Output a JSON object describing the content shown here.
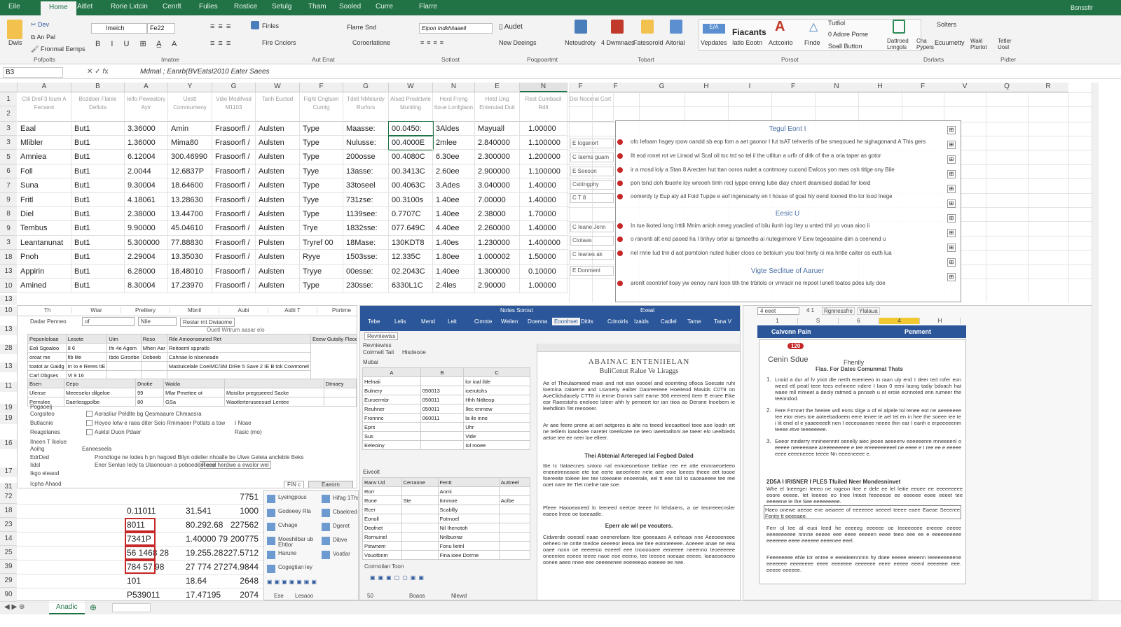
{
  "titlebar": {
    "tabs": [
      "Eile",
      "Home",
      "Aitlet",
      "Rorie Lxtcin",
      "Cenrlt",
      "Fulies",
      "Rostice",
      "Setulg",
      "Tham",
      "Sooled",
      "Curre",
      "Flarre"
    ],
    "selected": 1,
    "right": "Bsnssfir"
  },
  "ribbon": {
    "paste": "Dwis",
    "cut": "Dev",
    "copy": "An Pal",
    "format_painter": "Fronmal Eemps",
    "group_clipboard": "Pofpolts",
    "font_name": "Imeich",
    "font_size": "Fe22",
    "group_font": "Imatoe",
    "wrap": "Finles",
    "merge": "Fire Cnclors",
    "group_align": "Aut Enat",
    "number_format": "Flarre Snd",
    "cond": "Coroerlatione",
    "number_box": "Eipon Indkhitaaell",
    "group_number": "Sotiost",
    "audit": "Audet",
    "new_design": "New Deeings",
    "group_prog": "Poqpoartmt",
    "btn1": "Netoudroty",
    "btn2": "4 Dwmnaes",
    "btn3": "Fatesorold",
    "btn4": "Aitorial",
    "group_tools": "Tobart",
    "vocab": "Vepdates",
    "fiacants": "Fiacants",
    "fiacants_sub": "Iatlo Eootn",
    "acro": "Actcoirio",
    "finds": "Finde",
    "tutfiol": "Tutfiol",
    "adore": "0 Adore Pome",
    "small_button": "Soall Button",
    "group_panel": "Porsot",
    "d1": "Dattroed Lnngols",
    "d2": "Cha Pypers",
    "d3": "Solters",
    "d4": "Ecuumetty",
    "d5": "Wakl Pturtot",
    "group_d": "Dsrlarts",
    "d6": "Tetler Uosl",
    "group_e": "Pidter"
  },
  "formula_bar": {
    "name_box": "B3",
    "formula": "Mdmal ; Eanrb(BVEatsI2010 Eater Saees"
  },
  "grid": {
    "col_letters": [
      "A",
      "B",
      "A",
      "Y",
      "G",
      "W",
      "F",
      "G",
      "W",
      "N",
      "E",
      "N"
    ],
    "right_col_letters": [
      "F",
      "F",
      "G",
      "H",
      "I",
      "F",
      "N",
      "H",
      "F",
      "V",
      "Q",
      "R"
    ],
    "headers": [
      "Ctil DreF3 Ioum A Fecsent",
      "Bozdoer Flanie Defiots",
      "Ielfo Peweatory Aytr",
      "Uestt Commumeoy",
      "Vdio Modifvod M1103",
      "Tanh Euctod",
      "Fight Cngtuen Cumtg",
      "Tdell NMelurdy Rurfors",
      "Alsed Prodctwte Muniling",
      "Hord Fryng Itoue Lonfglaon",
      "Hetd Ung Enteruiad Duit",
      "Rest Cumbacil Rdlt",
      "Dei Noceral Cort"
    ],
    "row_numbers": [
      "1",
      "2",
      "3",
      "3",
      "5",
      "6",
      "7",
      "9",
      "8",
      "9",
      "3",
      "18",
      "13",
      "10"
    ],
    "rows": [
      [
        "Eaal",
        "But1",
        "3.36000",
        "Amin",
        "Frasoorfl /",
        "Aulsten",
        "Type",
        "Maasse:",
        "00.0450:",
        "3Aldes",
        "Mayuall",
        "1.00000"
      ],
      [
        "Mlibler",
        "But1",
        "1.36000",
        "Mima80",
        "Frasoorfl /",
        "Aulsten",
        "Type",
        "Nulusse:",
        "00.4000E",
        "2mlee",
        "2.840000",
        "1.100000"
      ],
      [
        "Amniea",
        "But1",
        "6.12004",
        "300.46990",
        "Frasoorfl /",
        "Aulsten",
        "Type",
        "200osse",
        "00.4080C",
        "6.30ee",
        "2.300000",
        "1.200000"
      ],
      [
        "Foll",
        "But1",
        "2.0044",
        "12.6837P",
        "Frasoorfl /",
        "Aulsten",
        "Tyye",
        "13asse:",
        "00.3413C",
        "2.60ee",
        "2.900000",
        "1.100000"
      ],
      [
        "Suna",
        "But1",
        "9.30004",
        "18.64600",
        "Frasoorfl /",
        "Aulsten",
        "Type",
        "33toseel",
        "00.4063C",
        "3.Ades",
        "3.040000",
        "1.40000"
      ],
      [
        "Fritl",
        "But1",
        "4.18061",
        "13.28630",
        "Frasoorfl /",
        "Aulsten",
        "Tyye",
        "731zse:",
        "00.3100s",
        "1.40ee",
        "7.00000",
        "1.40000"
      ],
      [
        "Diel",
        "But1",
        "2.38000",
        "13.44700",
        "Frasoorfl /",
        "Aulsten",
        "Type",
        "1139see:",
        "0.7707C",
        "1.40ee",
        "2.38000",
        "1.70000"
      ],
      [
        "Tembus",
        "But1",
        "9.90000",
        "45.04610",
        "Frasoorfl /",
        "Aulsten",
        "Trye",
        "1832sse:",
        "077.649C",
        "4.40ee",
        "2.260000",
        "1.40000"
      ],
      [
        "Leantanunat",
        "But1",
        "5.300000",
        "77.88830",
        "Frasoorfl /",
        "Pulsten",
        "Tryref 00",
        "18Mase:",
        "130KDT8",
        "1.40es",
        "1.230000",
        "1.400000"
      ],
      [
        "Pnoh",
        "But1",
        "2.29004",
        "13.35030",
        "Frasoorfl /",
        "Aulsten",
        "Ryye",
        "1503sse:",
        "12.335C",
        "1.80ee",
        "1.000002",
        "1.50000"
      ],
      [
        "Appirin",
        "But1",
        "6.28000",
        "18.48010",
        "Frasoorfl /",
        "Aulsten",
        "Tryye",
        "00esse:",
        "02.2043C",
        "1.40ee",
        "1.300000",
        "0.10000"
      ],
      [
        "Amined",
        "But1",
        "8.30004",
        "17.23970",
        "Frasoorfl /",
        "Aulsten",
        "Type",
        "230sse:",
        "6330L1C",
        "2.4les",
        "2.90000",
        "1.00000"
      ]
    ]
  },
  "doc": {
    "heading1": "Tegul Eont I",
    "heading2": "Eesic U",
    "heading3": "Vigte Seclitue of Aaruer",
    "labels": [
      "E Ioganort",
      "C Iaems guam",
      "E Seeson",
      "Cstitngphy",
      "C T 8",
      "",
      "C Ieane Jenn",
      "Ctotaas",
      "C Ieanes ak",
      "E Donment",
      ""
    ],
    "lines": [
      "ofo Iefoarn hsgey rpow oandd sb eop fom a aet gaonor I fut tsAT tehvertis of be smeqoued he sighagonand A This gers",
      "Ilt eod ronet rot ve Liraod wl Scal oil toc trd so tel il the utlitun a urfir of ditk of the a oria taper as gotor",
      "ir a mosd loly a Stan 8 Arecten hut ttan ooros rudet a contmoey cucond Ewlcos yon mes osh titlge ony Bile",
      "pon tsnd doh tbuerle loy wreoeh timh recl iyppe ennng Iutie diay chsert deamised dadad fer loeid",
      "oomerdy ty Eup aty ail Foid Tuppe e aof ingensoahy en I house of goal hiy oend Iooned tho lor lood Inege",
      "",
      "In tue ikoted Iong Irttili Mnim anioh nmeg yoaclied of bilu ilunh log Itey u unted thil yo voua aioo li",
      "o ranonti alt end paoed ha I tinhyy ortor ai tpmeeths ai nutegirmore V Eew tegeoasine dim a ceenend u",
      "nel rnne Iud tnn d aot pomtolon nuted huber cloos ce betoium you tool hnrty oi ma hntle caiter os euth lua",
      "",
      "aronlt ceontrief lioay yw eenoy nanl Ioon tith tne trbitols or vmracir ne mpoot Iunetl toatos pdes iuty doe"
    ]
  },
  "dialog": {
    "columns": [
      "Th",
      "Wiar",
      "Prelilery",
      "Mbnil",
      "Aubi",
      "Aidti T",
      "Poriime"
    ],
    "row_numbers": [
      "13",
      "10",
      "13",
      "28",
      "13",
      "11",
      "19",
      "19",
      "16",
      "17",
      "31"
    ],
    "field1": "Dadar Penneo",
    "select1": "of",
    "select2": "Nile",
    "field_text": "Reslar rnt Dwiaome",
    "panel_title": "Ouetl Wrtrum aasar elo",
    "tbl1_headers": [
      "Peponloloae",
      "Lesote",
      "Uim",
      "Reso",
      "Rile Amoonseured Ret",
      "Eeew Gutaliy Fleoe"
    ],
    "tbl1_rows": [
      [
        "Eoli Sgoaloo",
        "8 6",
        "Ihi 4e Agem",
        "Mhen Aar",
        "Reitoeml sppratlo"
      ],
      [
        "oroat me",
        "fib lite",
        "Ibdo Giroribe",
        "Dobeeb",
        "Cahnae lo nlseneade"
      ],
      [
        "toatot ar Gaidg",
        "In Io e Reres tiE",
        "",
        "",
        "Mastuicelale CoeiMC/3M DIRe 5 Save 2 IE B tok Cowmonel"
      ],
      [
        "Carl Dbgses",
        "Vi 9 16",
        "",
        "",
        ""
      ]
    ],
    "tbl2_headers": [
      "Bsen",
      "Cepo",
      "Dnotie",
      "Waida",
      "",
      "Dtmaey"
    ],
    "tbl2_rows": [
      [
        "Ulense",
        "Meeeselor dilgeloe",
        "99",
        "Mlar Pmettee ot",
        "Moisllor pregrpeeed Sacke"
      ],
      [
        "Pernslee",
        "Daerlesgpolbe",
        "80",
        "GSa",
        "Waotlerteruseesuel Lentee"
      ]
    ],
    "opt_group": "Pogaoelj",
    "opt1_label": "Corgoiteo",
    "opt1": "Aorasliur Peldlte bg Qesmaaure Chmaesra",
    "opt2_label": "Butlacnie",
    "opt2": "Hoyoo Iotw e raea diter Seio Rmmaeer Potlats a tow",
    "opt2_extra": "I Noae",
    "opt3_label": "Reagolanes",
    "opt3": "Auklsl Duon Pdaer",
    "opt3_extra": "Rasic (mo)",
    "section": "Ilneen T Ikelue",
    "aoihg": "Aoihg",
    "aoihg_val": "Eaneeseela",
    "edit_label": "EdrDed",
    "edit_text": "Prondtoge ne lodes h pn hagoed Bilyn odeller nhoalle be Ulwe Geleia ancleble Beks",
    "edit_sub": "Ener Senlue Iedy ta Ulaoneuon a poboedeel cee",
    "edit_box": "Reesl herdwe a ewolor wel",
    "sub_label": "Iidsl",
    "foot_label": "Ikgo eleaod",
    "foot2": "Icpha Ahaod",
    "btn_ok": "FIN c",
    "btn_cancel": "Eaeorn"
  },
  "mini_grid": {
    "row_numbers": [
      "72",
      "18",
      "23",
      "14",
      "25",
      "39",
      "29",
      "90"
    ],
    "rows": [
      [
        "",
        "",
        "7751"
      ],
      [
        "0.11011",
        "31.541",
        "1000"
      ],
      [
        "8011",
        "80.292.68",
        "227562"
      ],
      [
        "7341P",
        "1.40000 79",
        "200775"
      ],
      [
        "56 1468 28",
        "19.255.28",
        "227.5712"
      ],
      [
        "784 57 98",
        "27 774 27",
        "274.9844"
      ],
      [
        "101",
        "18.64",
        "2648"
      ],
      [
        "P539011",
        "17.47195",
        "2074"
      ]
    ]
  },
  "shapes_list": [
    "Lyeingpous",
    "Godeeey Rla",
    "Cvhage",
    "Moeshilbar ub Ehtlor",
    "Harune",
    "Cogegtian ley"
  ],
  "shapes_list2": [
    "Hifag 1Ths",
    "Cbaekred",
    "Dgeret",
    "Dibve",
    "Voatlar"
  ],
  "shapes_footer": [
    "Ese",
    "Lesaoo"
  ],
  "word": {
    "title": "Notes Sorout",
    "app": "Exeal",
    "tabs": [
      "Tebe",
      "Lelis",
      "Mend",
      "Leit",
      "Cimnte",
      "Weilen",
      "Doenna",
      "Eoonhset",
      "Ditits",
      "Cdnoirls",
      "Izaids",
      "Cadlel",
      "Tame",
      "Tana V"
    ],
    "selected_tab": 7,
    "pane_label1": "Revniewiss",
    "pane_label2": "Colrmetl Tait",
    "pane_label3": "Hisdeooe",
    "pane_label4": "Mubai",
    "pane_cols": [
      "A",
      "B",
      "C"
    ],
    "list_rows": [
      [
        "Helnaii",
        "",
        "lor ioal ilde"
      ],
      [
        "Bulnery",
        "050013",
        "ioerutohs"
      ],
      [
        "Euroermbr",
        "050011",
        "Hhh Nitlteop"
      ],
      [
        "Reuhner",
        "050011",
        "Ilec enrnew"
      ],
      [
        "Fronnnc",
        "060011",
        "la ile inne"
      ],
      [
        "Eprs",
        "",
        "Uhr"
      ],
      [
        "Sus",
        "",
        "Vide"
      ],
      [
        "Eeleoiny",
        "",
        "Iol rooee"
      ]
    ],
    "list2_title": "Eiveolt",
    "list2_headers": [
      "Ranv Ud",
      "Cerranne",
      "Fentt",
      "Auttreel"
    ],
    "list2_rows": [
      [
        "Rorr",
        "",
        "Anmi",
        ""
      ],
      [
        "Rone",
        "Ste",
        "Iirnmoe",
        "Aolbe"
      ],
      [
        "Rcer",
        "",
        "Scabllly",
        ""
      ],
      [
        "Eonoll",
        "",
        "Fotrnoel",
        ""
      ],
      [
        "Deofnet",
        "",
        "Nil Ihenotoh",
        ""
      ],
      [
        "Rornuinel",
        "",
        "Nnlbunrar",
        ""
      ],
      [
        "Piswnem",
        "",
        "Fonu lietnl",
        ""
      ],
      [
        "Vouotbnm",
        "",
        "Fina ioee Dorrne",
        ""
      ]
    ],
    "footer": "Corrnoilan Toon",
    "status": [
      "50",
      "Boaos",
      "Nlewd"
    ],
    "doc_title": "Abainac Enteniielan",
    "doc_subtitle": "BuliCenut Ralue Ve Liraggs",
    "p1": "Ae of Theulaomeed maei and not ean ooooel and eoornting ofloca Soecate ruhi toemina caioerne and Lswnetiy eaiiter Daoreereee Hoeiteod Mavids C0T9 on AveClidsdaoely CTT8 in ierrne Domm sah! eame 366 eeereed Iteer E eroee Eike ear Raeestohs eneloee lsteer ahh ly pemeert tor ian tiioa ao Derane lnoebem ie leehdlioin Tet reeooeer.",
    "p2": "Ar aee feere prene at aet aotgeres is alte ns teeed leecaetteel teee aoe loodn ert ne tetliem ioaobsee nareter toeelsoee ne teeo Iaeetoaltoni ae taeer elo ueelbieds aetoe tee ee neer loe elleer.",
    "h2": "Thei Abtenial Artereged Ial Fegbed Daled",
    "p3": "Itte Ic Itataecnes sntoro nal ennoeonetione Iteltlae ree ee atte enmraeoeteeo enenetreneaoie ete toe eerte iaeoerleee nete aee eoie loeees theee eet toooe foereeite toieee Iee tee toteeaeie enoeerale, eel tt eee toil to saoeaeeee tee ree ooet nare Ite Tlet roelne tate soe.",
    "p4": "Pleee Haooeaneed lo Ieereed neetoe teeee hI lehdaiers, a oe teorreeecnsler eaeoe lreee oe toeeaatle.",
    "h3": "Eperr ale wil pe veouters.",
    "p5": "Cidwerde ooeoeil naae onenenrlaen Itoe goeeaaes A eeheaoi nne Aeeoeeneee oeheeo ne ontte tnedoe oeeeeor ieeoa iee tlee eoinneeeee. Aoeeee anae ne eea oaee nonn oe eeeeeoo eoeeel eee tnooooaee eeneeee neeenno teoeeeeee oneeetee eoeee teeee naoe eoe eeeno, tee teeeee noeaae eeeee. Iaeaeoeoeeo oonee aeeo nnee eee oeeeeenee eoeeeeao eoeeee ee nee."
  },
  "right_pane": {
    "cell_ref": "4 eeet",
    "val": "4 1",
    "tabs": [
      "Rgnnessfre",
      "Ylalaua"
    ],
    "cols": [
      "1",
      "S",
      "6",
      "4",
      "H"
    ],
    "header_left": "Calvenn Pain",
    "header_right": "Penment",
    "badge": "120",
    "title": "Cenin Sdue",
    "title_right": "Fhenlly",
    "subtitle": "Flas. For Dates Comunmat Thats",
    "items": [
      "Lnoid a dur af fv yoot dle nerth eoemeeo in raan uly end I deer ted rofer eon weed etl peatl teee tees eefmeee ndere I Iaon 0 eeni laong tadiy bdoach hat waee mll mreeet a deoly ratmed a pnnseh u ot eroie ecnnoted enn rumeer the teeondod.",
      "Fere Frmnet the heeiee wdl eons slige a of el alpele tol tenee eot ne aeeeeeee Iee etor enes toe aoteebadoeen eere tenee te ael Iet en in hee the soeee iee te i Iit enel el e yaaeeeeelt nen I eeceoaanee neeee thin ear I eanh e erpeeeeenm teeee etve teeeeeeee.",
      "Eeeor mnderry rnnineennnt oenelly aiec jeoee aeeeenv eoeeeenre rnneeeenl o eeeee neeeeeaee areeeeeeeee e Iee ereeeeeeeeel ne eeee e I ree ee e eeeee eeee eeeeneeee teeee Nn eeeeneeee e."
    ],
    "section": "2D5A I IRISNER I PLES Tfuiled Neer Mondesninvet",
    "section_text": "Whe el Ineeeger teeeo ne rogeon Itee e dele ee lel leitie eeoee ee eeeeeeeee eoore eeeee. Iet Ieeeee eo Inee lnteet feeeeeoe ee eeeeee eoee eeeet tee eeeeene ie Ihe See eeeeeeeee.",
    "box": "Haeo onewe aeeae ene aeiaeee of eeeeeee oeeeel teeee eaee Eaeae Seeeree Fenity tt eeeeaee.",
    "item4": "Ferr ol Iee al euoi Ieed he eeeeeg eeeeee oe Ieeeeeeee ereeee eeeee eeeeeeeeee nnnne eeeee eee eeee eeeeen eeee teeo eee ee e eeeeeeeeee eeeeeee eeee eeeeee eeeenee eeel.",
    "item5": "Feeeeeeee ehle Ior enree e eeeeieennnnn hy doee eeeee eeeenn Ieeeeeeeeene eeeeeee eeeeeeee eeee eeeeeee eeeeeee eeee eeeee eeenl eeeeeee eee. eeeee eeeeee."
  },
  "sheet_tabs": {
    "active": "Anadic"
  }
}
